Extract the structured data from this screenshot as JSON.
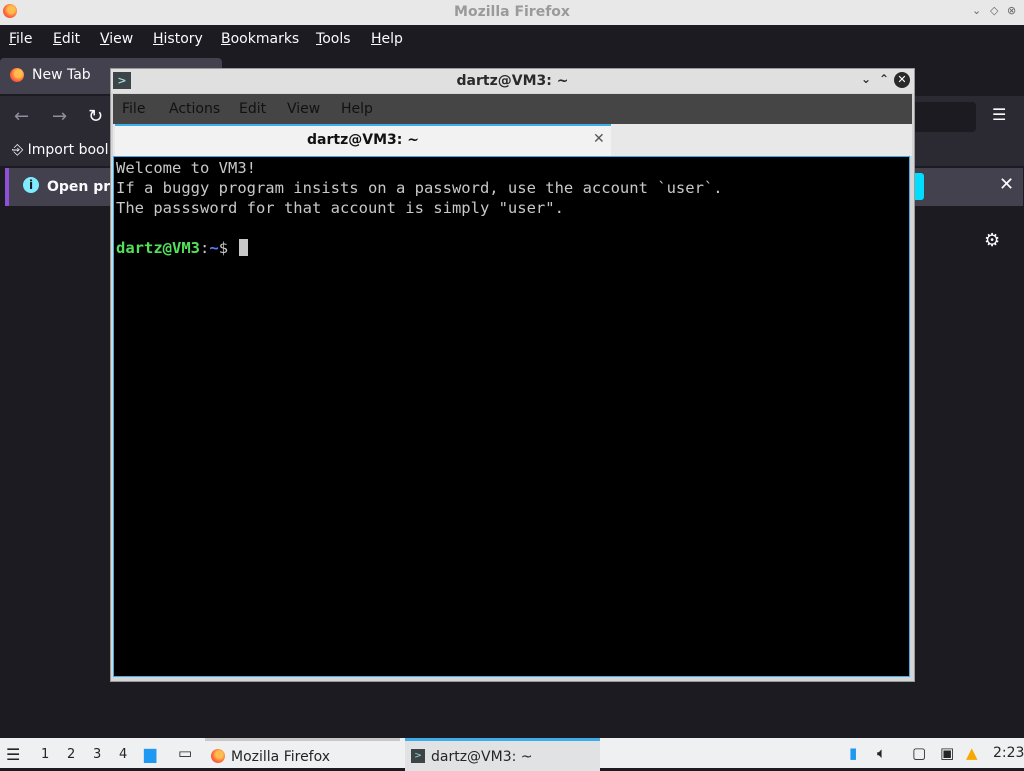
{
  "firefox": {
    "window_title": "Mozilla Firefox",
    "menu": [
      "File",
      "Edit",
      "View",
      "History",
      "Bookmarks",
      "Tools",
      "Help"
    ],
    "tab_label": "New Tab",
    "bookmarks_import_label": "Import bool",
    "notification_text": "Open pre",
    "window_controls": [
      "⌄",
      "◇",
      "⊗"
    ]
  },
  "terminal": {
    "window_title": "dartz@VM3: ~",
    "menu": [
      "File",
      "Actions",
      "Edit",
      "View",
      "Help"
    ],
    "tab_label": "dartz@VM3: ~",
    "output_lines": [
      "Welcome to VM3!",
      "If a buggy program insists on a password, use the account `user`.",
      "The passsword for that account is simply \"user\"."
    ],
    "prompt": {
      "user_host": "dartz@VM3",
      "separator": ":",
      "path": "~",
      "symbol": "$ "
    }
  },
  "taskbar": {
    "desktops": [
      "1",
      "2",
      "3",
      "4"
    ],
    "windows": [
      {
        "label": "Mozilla Firefox",
        "active": false
      },
      {
        "label": "dartz@VM3: ~",
        "active": true
      }
    ],
    "clock": "2:23"
  },
  "colors": {
    "accent": "#3daee9",
    "prompt_user": "#55e05c",
    "prompt_path": "#5b7fff"
  }
}
